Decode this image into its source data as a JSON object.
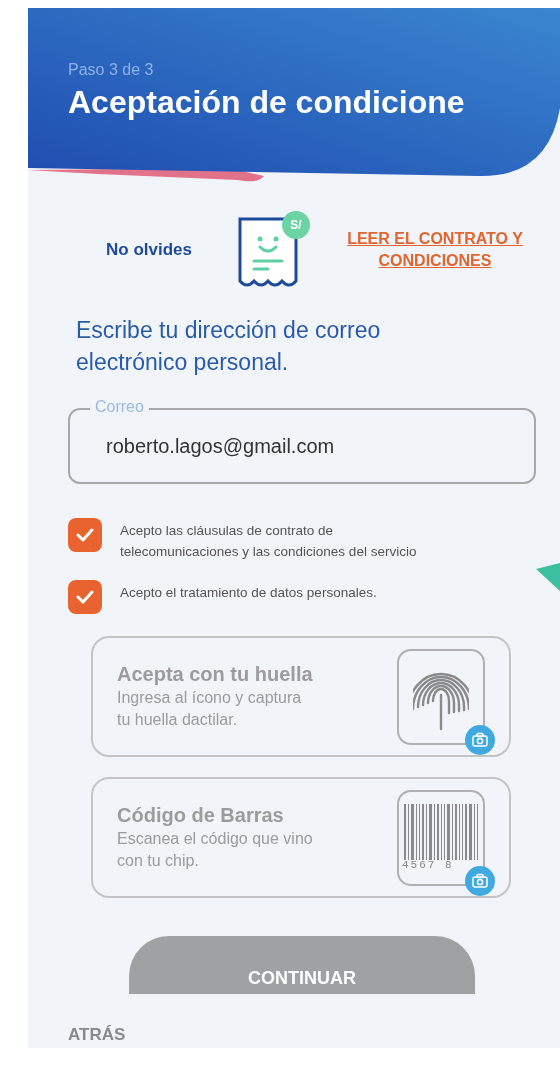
{
  "header": {
    "step": "Paso 3 de 3",
    "title": "Aceptación de condicione"
  },
  "reminder": {
    "label": "No olvides",
    "badge": "S/",
    "link": "LEER EL CONTRATO Y CONDICIONES"
  },
  "email": {
    "prompt": "Escribe tu dirección de correo electrónico personal.",
    "label": "Correo",
    "value": "roberto.lagos@gmail.com"
  },
  "consents": [
    {
      "label": "Acepto las cláusulas de contrato de telecomunicaciones y las condiciones del servicio",
      "checked": true
    },
    {
      "label": "Acepto el tratamiento de datos personales.",
      "checked": true
    }
  ],
  "options": [
    {
      "kind": "fingerprint",
      "title": "Acepta con tu huella",
      "description": "Ingresa al ícono y captura tu huella dactilar.",
      "disabled": true
    },
    {
      "kind": "barcode",
      "title": "Código de Barras",
      "description": "Escanea el código que vino con tu chip.",
      "digits": "4567 8",
      "disabled": true
    }
  ],
  "continue_button": {
    "label": "CONTINUAR",
    "disabled": true
  },
  "back_link": {
    "label": "ATRÁS"
  }
}
